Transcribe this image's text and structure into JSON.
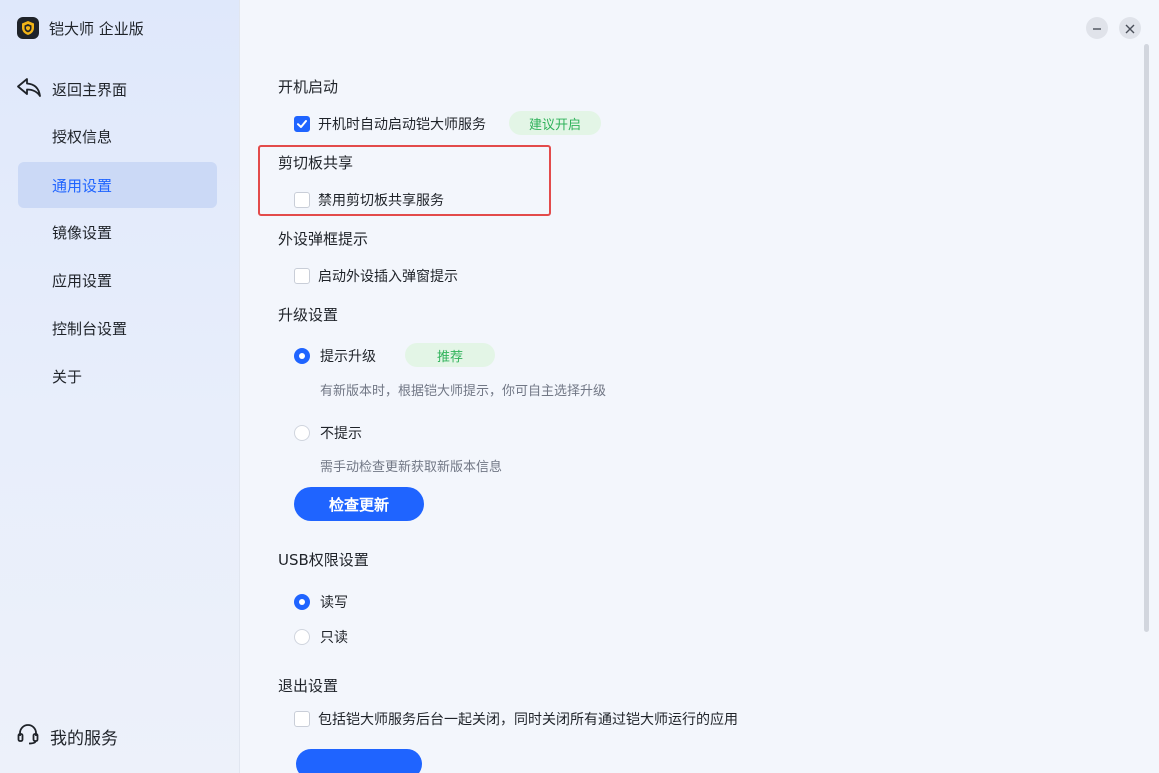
{
  "app": {
    "title": "铠大师 企业版",
    "logo_icon": "shield-logo-icon"
  },
  "sidebar": {
    "back_label": "返回主界面",
    "items": [
      {
        "label": "授权信息",
        "active": false
      },
      {
        "label": "通用设置",
        "active": true
      },
      {
        "label": "镜像设置",
        "active": false
      },
      {
        "label": "应用设置",
        "active": false
      },
      {
        "label": "控制台设置",
        "active": false
      },
      {
        "label": "关于",
        "active": false
      }
    ],
    "service_label": "我的服务"
  },
  "window_controls": {
    "minimize_icon": "minus-icon",
    "close_icon": "close-icon"
  },
  "sections": {
    "startup": {
      "title": "开机启动",
      "option": {
        "label": "开机时自动启动铠大师服务",
        "checked": true
      },
      "badge": "建议开启"
    },
    "clipboard": {
      "title": "剪切板共享",
      "option": {
        "label": "禁用剪切板共享服务",
        "checked": false
      }
    },
    "peripheral": {
      "title": "外设弹框提示",
      "option": {
        "label": "启动外设插入弹窗提示",
        "checked": false
      }
    },
    "upgrade": {
      "title": "升级设置",
      "prompt": {
        "label": "提示升级",
        "checked": true,
        "badge": "推荐",
        "desc": "有新版本时，根据铠大师提示，你可自主选择升级"
      },
      "no_prompt": {
        "label": "不提示",
        "checked": false,
        "desc": "需手动检查更新获取新版本信息"
      },
      "check_button": "检查更新"
    },
    "usb": {
      "title": "USB权限设置",
      "read_write": {
        "label": "读写",
        "checked": true
      },
      "read_only": {
        "label": "只读",
        "checked": false
      }
    },
    "exit": {
      "title": "退出设置",
      "option": {
        "label": "包括铠大师服务后台一起关闭，同时关闭所有通过铠大师运行的应用",
        "checked": false
      }
    }
  },
  "colors": {
    "accent": "#1f64ff",
    "badge_bg": "#e3f5e6",
    "badge_text": "#2fb25a",
    "highlight": "#e34b4b"
  }
}
